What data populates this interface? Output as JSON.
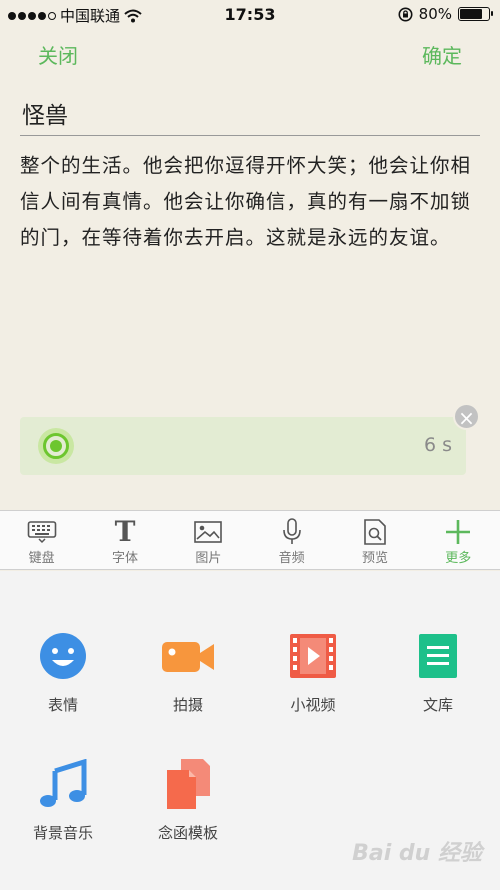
{
  "status_bar": {
    "carrier": "中国联通",
    "time": "17:53",
    "battery_percent": "80%",
    "battery_level": 0.8
  },
  "nav": {
    "close_label": "关闭",
    "confirm_label": "确定"
  },
  "document": {
    "title": "怪兽",
    "body": "整个的生活。他会把你逗得开怀大笑；他会让你相信人间有真情。他会让你确信，真的有一扇不加锁的门，在等待着你去开启。这就是永远的友谊。"
  },
  "audio": {
    "duration": "6 s"
  },
  "toolbar": {
    "items": [
      {
        "label": "键盘",
        "icon": "keyboard-icon"
      },
      {
        "label": "字体",
        "icon": "font-icon"
      },
      {
        "label": "图片",
        "icon": "image-icon"
      },
      {
        "label": "音频",
        "icon": "microphone-icon"
      },
      {
        "label": "预览",
        "icon": "preview-icon"
      },
      {
        "label": "更多",
        "icon": "plus-icon"
      }
    ]
  },
  "more_panel": {
    "items": [
      {
        "label": "表情",
        "icon": "emoji-icon",
        "color": "#3d8fe4"
      },
      {
        "label": "拍摄",
        "icon": "camera-icon",
        "color": "#f7963d"
      },
      {
        "label": "小视频",
        "icon": "film-icon",
        "color": "#ef5b45"
      },
      {
        "label": "文库",
        "icon": "document-icon",
        "color": "#1dc08a"
      },
      {
        "label": "背景音乐",
        "icon": "music-note-icon",
        "color": "#3d8fe4"
      },
      {
        "label": "念函模板",
        "icon": "template-icon",
        "color": "#f56a4c"
      }
    ]
  },
  "colors": {
    "accent": "#5cb85c",
    "background": "#f2eee4"
  },
  "watermark": "Bai du 经验"
}
